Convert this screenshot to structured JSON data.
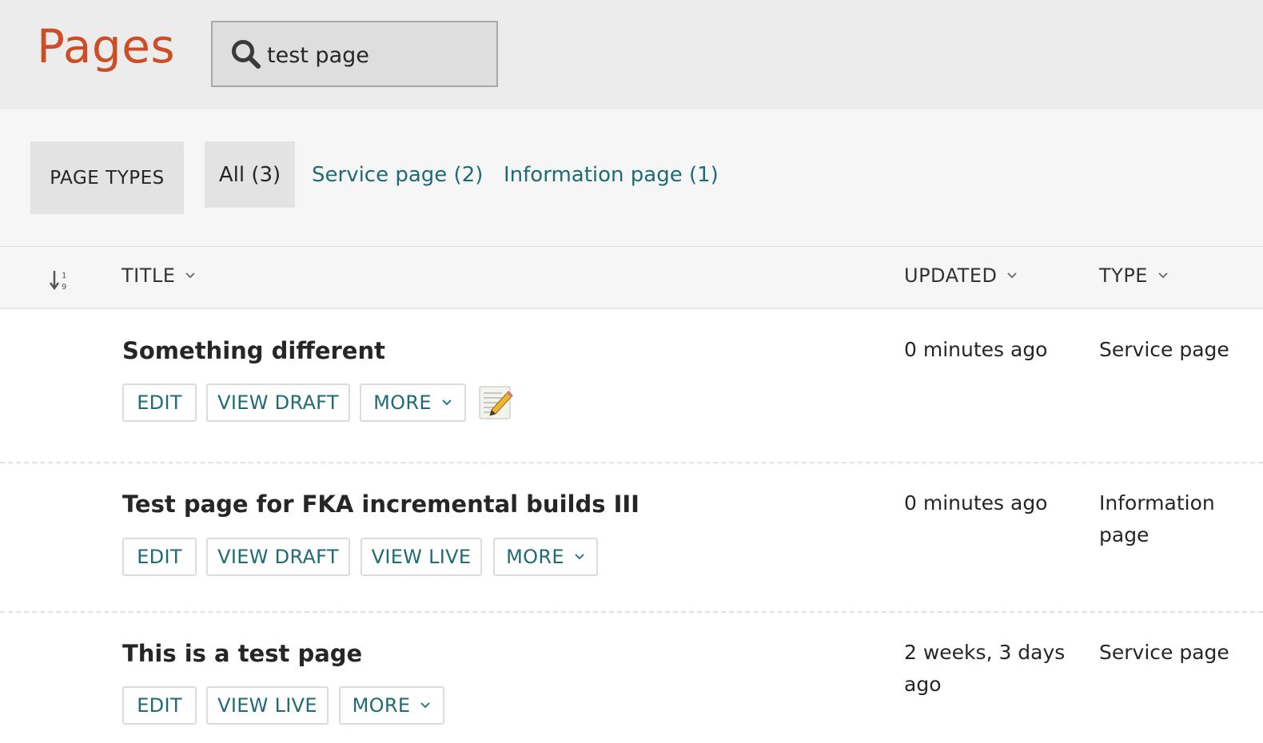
{
  "header": {
    "title": "Pages",
    "search_value": "test page",
    "search_icon": "search-icon"
  },
  "filters": {
    "label": "PAGE TYPES",
    "tabs": [
      {
        "label": "All (3)",
        "active": true
      },
      {
        "label": "Service page (2)",
        "active": false
      },
      {
        "label": "Information page (1)",
        "active": false
      }
    ]
  },
  "columns": {
    "sort_icon": "sort-numeric-icon",
    "title": "TITLE",
    "updated": "UPDATED",
    "type": "TYPE"
  },
  "rows": [
    {
      "title": "Something different",
      "updated": "0 minutes ago",
      "type": "Service page",
      "buttons": [
        "EDIT",
        "VIEW DRAFT",
        "MORE"
      ],
      "status_icon": "draft-memo-icon"
    },
    {
      "title": "Test page for FKA incremental builds III",
      "updated": "0 minutes ago",
      "type": "Information page",
      "buttons": [
        "EDIT",
        "VIEW DRAFT",
        "VIEW LIVE",
        "MORE"
      ]
    },
    {
      "title": "This is a test page",
      "updated": "2 weeks, 3 days ago",
      "type": "Service page",
      "buttons": [
        "EDIT",
        "VIEW LIVE",
        "MORE"
      ]
    }
  ],
  "colors": {
    "title": "#cd4e26",
    "link": "#1e6c71",
    "header_bg": "#ececec"
  }
}
